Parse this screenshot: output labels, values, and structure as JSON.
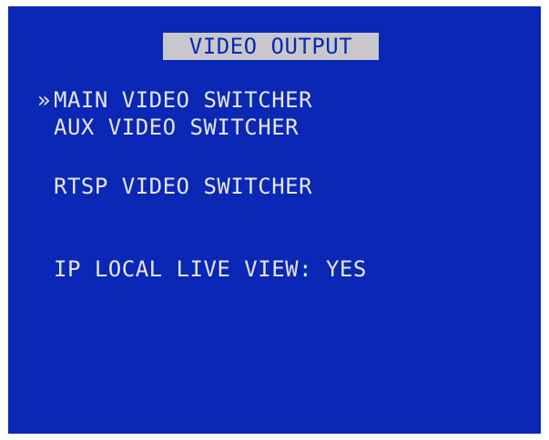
{
  "screen": {
    "title": "VIDEO OUTPUT",
    "background_color": "#0b27b6",
    "title_bar_color": "#c8c8cc",
    "text_color": "#e6e6ea"
  },
  "cursor": {
    "symbol": "»"
  },
  "menu": {
    "items": [
      {
        "label": "MAIN VIDEO SWITCHER",
        "selected": true
      },
      {
        "label": "AUX VIDEO SWITCHER",
        "selected": false
      },
      {
        "label": "RTSP VIDEO SWITCHER",
        "selected": false
      },
      {
        "label": "IP LOCAL LIVE VIEW: YES",
        "selected": false
      }
    ]
  }
}
